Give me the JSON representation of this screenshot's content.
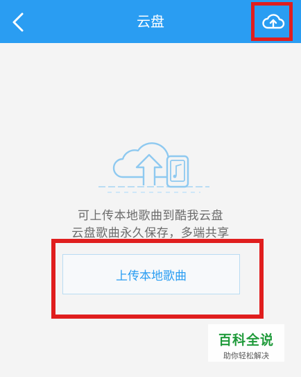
{
  "header": {
    "title": "云盘",
    "back_icon": "chevron-left-icon",
    "upload_icon": "cloud-upload-icon"
  },
  "empty_state": {
    "illustration_icon": "cloud-upload-phone-illustration",
    "line1": "可上传本地歌曲到酷我云盘",
    "line2": "云盘歌曲永久保存，多端共享"
  },
  "upload_local_button": {
    "label": "上传本地歌曲"
  },
  "watermark": {
    "title": "百科全说",
    "subtitle": "助你轻松解决"
  },
  "colors": {
    "header_bg": "#2a9df2",
    "accent": "#2a9df2",
    "highlight": "#e01e1e",
    "watermark_green": "#1f9a3a"
  }
}
